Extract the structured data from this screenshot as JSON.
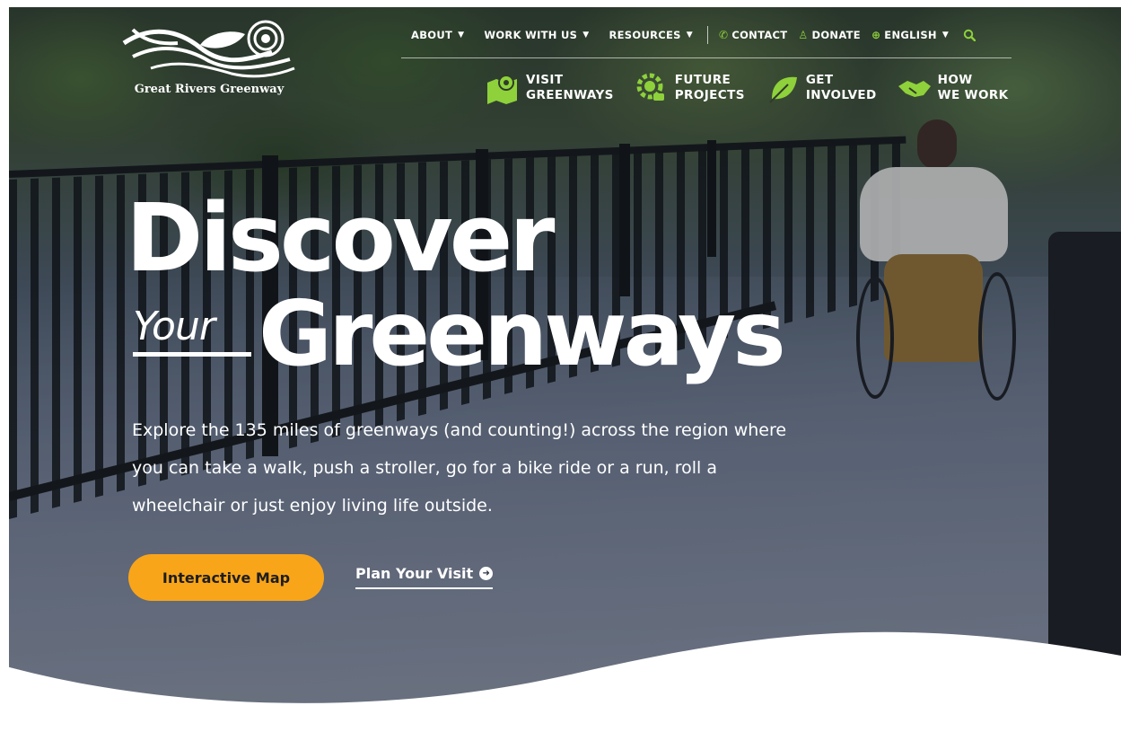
{
  "brand": {
    "name": "Great Rivers Greenway",
    "logo_icon": "river-leaf-logo"
  },
  "top_nav": {
    "items": [
      {
        "label": "ABOUT",
        "has_dropdown": true
      },
      {
        "label": "WORK WITH US",
        "has_dropdown": true
      },
      {
        "label": "RESOURCES",
        "has_dropdown": true
      }
    ],
    "utility": [
      {
        "label": "CONTACT",
        "icon": "phone-icon"
      },
      {
        "label": "DONATE",
        "icon": "donate-icon"
      },
      {
        "label": "ENGLISH",
        "icon": "globe-icon",
        "has_dropdown": true
      }
    ],
    "search_icon": "search-icon"
  },
  "main_nav": [
    {
      "label": "VISIT\nGREENWAYS",
      "icon": "map-pin-icon"
    },
    {
      "label": "FUTURE\nPROJECTS",
      "icon": "gear-bulb-icon"
    },
    {
      "label": "GET\nINVOLVED",
      "icon": "leaf-icon"
    },
    {
      "label": "HOW\nWE WORK",
      "icon": "handshake-icon"
    }
  ],
  "hero": {
    "line1": "Discover",
    "your": "Your",
    "line2": "Greenways",
    "intro": "Explore the 135 miles of greenways (and counting!) across the region where you can take a walk, push a stroller, go for a bike ride or a run, roll a wheelchair or just enjoy living life outside.",
    "primary_cta": "Interactive Map",
    "secondary_cta": "Plan Your Visit"
  },
  "colors": {
    "accent_green": "#8ed13b",
    "cta_orange": "#f9a51a",
    "white": "#ffffff"
  }
}
